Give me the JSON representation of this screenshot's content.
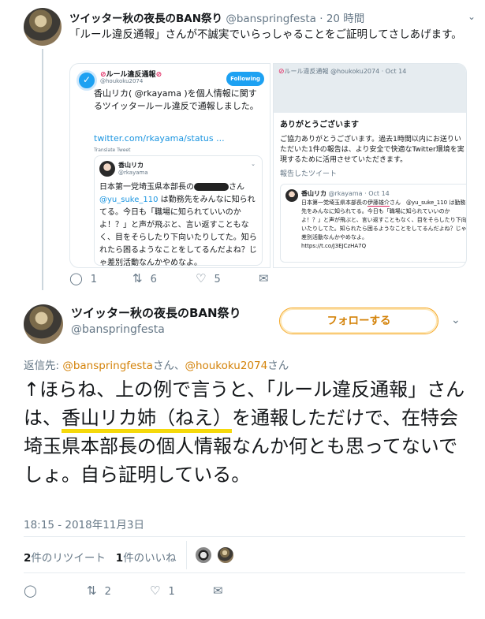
{
  "reply": {
    "name": "ツイッター秋の夜長のBAN祭り",
    "handle": "@banspringfesta",
    "dot": "·",
    "time": "20 時間",
    "text": "「ルール違反通報」さんが不誠実でいらっしゃることをご証明してさしあげます。",
    "image_left": {
      "account_name": "ルール違反通報",
      "account_handle": "@houkoku2074",
      "follow_label": "Following",
      "text": "香山リカ( @rkayama )を個人情報に関するツイッタールール違反で通報しました。",
      "link": "twitter.com/rkayama/status ...",
      "translate": "Translate Tweet",
      "quoted": {
        "name": "香山リカ",
        "handle": "@rkayama",
        "text_a": "日本第一党埼玉県本部長の",
        "text_b": "さん",
        "mention": "@yu_suke_110",
        "text_c": " は勤務先をみんなに知られてる。今日も「職場に知られていいのかよ！？」と声が飛ぶと、言い返すこともなく、目をそらしたり下向いたりしてた。知られたら困るようなことをしてるんだよね？じゃ差別活動なんかやめなよ。"
      }
    },
    "image_right": {
      "header": "ルール違反通報 @houkoku2074 · Oct 14",
      "title": "ありがとうございます",
      "body": "ご協力ありがとうございます。過去1時間以内にお送りいただいた1件の報告は、より安全で快適なTwitter環境を実現するために活用させていただきます。",
      "reported_label": "報告したツイート",
      "quoted": {
        "name": "香山リカ",
        "handle_time": "@rkayama · Oct 14",
        "text_a": "日本第一党埼玉県本部長の",
        "text_underlined": "伊藤雄介",
        "text_b": "さん　@yu_suke_110 は勤務先をみんなに知られてる。今日も「職場に知られていいのかよ！？」と声が飛ぶと、言い返すこともなく、目をそらしたり下向いたりしてた。知られたら困るようなことをしてるんだよね？じゃ差別活動なんかやめなよ。",
        "link": "https://t.co/J3EJCzHA7Q"
      }
    },
    "actions": {
      "reply_count": "1",
      "retweet_count": "6",
      "like_count": "5"
    }
  },
  "main": {
    "name": "ツイッター秋の夜長のBAN祭り",
    "handle": "@banspringfesta",
    "follow_label": "フォローする",
    "replying_prefix": "返信先: ",
    "replying_user1": "@banspringfesta",
    "replying_mid": "さん、",
    "replying_user2": "@houkoku2074",
    "replying_suffix": "さん",
    "text_a": "↑ほらね、上の例で言うと、「ルール違反通報」さんは、",
    "text_highlight": "香山リカ姉（ねえ）",
    "text_b": "を通報しただけで、在特会埼玉県本部長の個人情報なんか何とも思ってないでしょ。自ら証明している。",
    "timestamp": "18:15 - 2018年11月3日",
    "retweets_num": "2",
    "retweets_label": "件のリツイート",
    "likes_num": "1",
    "likes_label": "件のいいね",
    "actions": {
      "retweet_count": "2",
      "like_count": "1"
    }
  },
  "colors": {
    "follow_border": "#f5a623",
    "mention": "#d4830a",
    "highlight": "#f5d90a",
    "link": "#1b95e0"
  }
}
